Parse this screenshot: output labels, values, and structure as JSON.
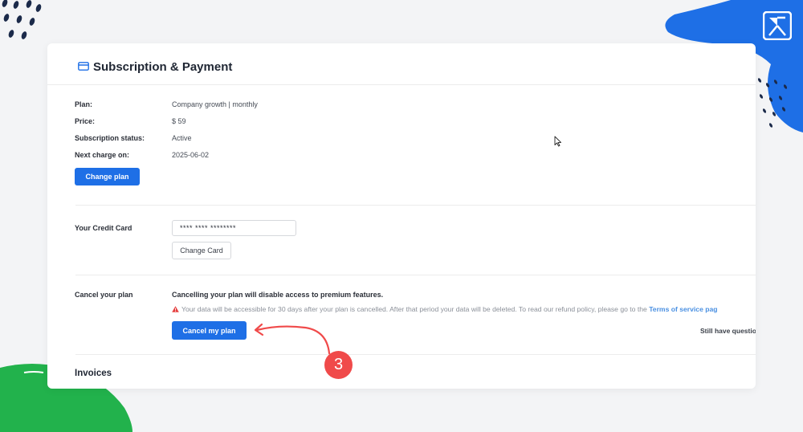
{
  "page": {
    "title": "Subscription & Payment"
  },
  "plan_section": {
    "plan_label": "Plan:",
    "plan_value": "Company growth | monthly",
    "price_label": "Price:",
    "price_value": "$ 59",
    "status_label": "Subscription status:",
    "status_value": "Active",
    "next_charge_label": "Next charge on:",
    "next_charge_value": "2025-06-02",
    "change_plan_button": "Change plan"
  },
  "card_section": {
    "label": "Your Credit Card",
    "card_number": "**** **** ********",
    "change_card_button": "Change Card"
  },
  "cancel_section": {
    "label": "Cancel your plan",
    "heading": "Cancelling your plan will disable access to premium features.",
    "warning_text": "Your data will be accessible for 30 days after your plan is cancelled. After that period your data will be deleted. To read our refund policy, please go to the",
    "warning_link": "Terms of service pag",
    "cancel_button": "Cancel my plan",
    "side_text": "Still have questio"
  },
  "invoices": {
    "title": "Invoices"
  },
  "annotation": {
    "step_number": "3",
    "color": "#f04a4a"
  },
  "colors": {
    "primary": "#1e6fe6",
    "background": "#f3f4f6",
    "brand_blue": "#1e6fe6",
    "deco_green": "#22b24c",
    "deco_navy": "#1b2a4a"
  },
  "icons": [
    "credit-card-icon",
    "warning-icon",
    "brand-logo-icon",
    "mouse-cursor-icon"
  ]
}
